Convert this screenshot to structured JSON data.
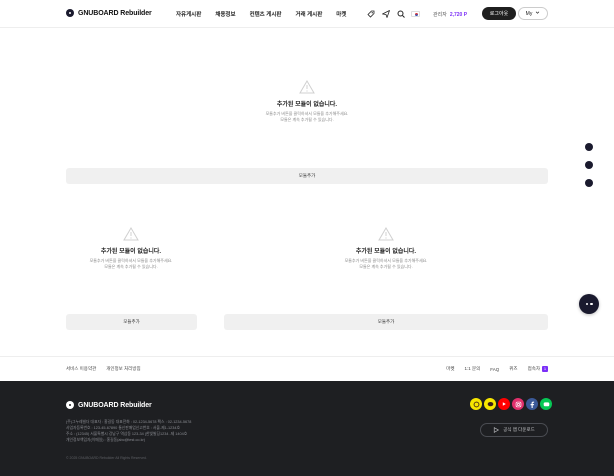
{
  "header": {
    "logo_text": "GNUBOARD Rebuilder",
    "nav": [
      "자유게시판",
      "채용정보",
      "컨텐츠 게시판",
      "거래 게시판",
      "마켓"
    ],
    "icons": [
      "rocket-icon",
      "send-icon",
      "search-icon",
      "korea-flag-icon"
    ],
    "points_label": "관리자",
    "points_value": "2,720 P",
    "logout_label": "로그아웃",
    "my_label": "My"
  },
  "modules": {
    "empty_title": "추가된 모듈이 없습니다.",
    "empty_desc_1": "모듈추가 버튼을 클릭하셔서 모듈을 추가해주세요.",
    "empty_desc_2": "모듈은 계속 추가될 수 있습니다.",
    "add_label": "모듈추가"
  },
  "footer_links": {
    "left": [
      "서비스 이용약관",
      "개인정보 처리방침"
    ],
    "right": [
      "마켓",
      "1:1 문의",
      "FAQ",
      "퀴즈",
      "접속자"
    ],
    "visitor_count": "1"
  },
  "footer": {
    "logo_text": "GNUBOARD Rebuilder",
    "info_1": "(주)그누레빌더   대표자 : 홍길동   대표전화 : 02-1234-5678   팩스 : 02-1234-5678",
    "info_2": "사업자등록번호 : 123-45-67890   통신판매업신고번호 : 서울-제1-1234호",
    "info_3": "주소 : (12345) 서울특별시 강남구 역삼동 123-34 (한빛빌딩1234 -제 1404호",
    "info_4": "개인정보책임자(이메일) : 홍길동(abc@test.co.kr)",
    "copyright": "© 2025 GNUBOARD Rebuilder All Rights Reserved.",
    "app_label": "공식 앱 다운로드",
    "socials": [
      {
        "name": "kakao-channel-icon",
        "color": "#f7e600"
      },
      {
        "name": "kakaotalk-icon",
        "color": "#f7e600"
      },
      {
        "name": "youtube-icon",
        "color": "#ff0000"
      },
      {
        "name": "instagram-icon",
        "color": "#e1306c"
      },
      {
        "name": "facebook-icon",
        "color": "#3b5998"
      },
      {
        "name": "line-icon",
        "color": "#06c755"
      }
    ]
  },
  "colors": {
    "accent": "#7b2ff7",
    "dark": "#1e1f22",
    "button_bg": "#f0f0f0"
  }
}
